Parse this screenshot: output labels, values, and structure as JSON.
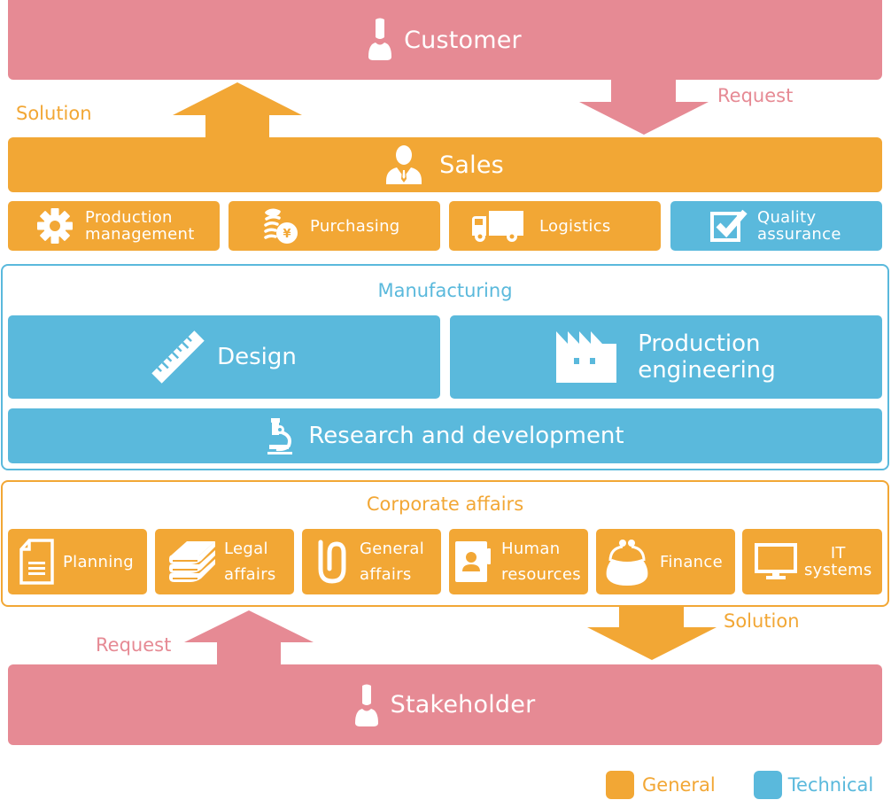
{
  "colors": {
    "pink": "#e68a94",
    "orange": "#f2a735",
    "blue": "#5ab9dc",
    "white": "#ffffff"
  },
  "customer": {
    "label": "Customer",
    "icon": "person-icon"
  },
  "sales": {
    "label": "Sales",
    "icon": "businessman-icon"
  },
  "flows": {
    "top_solution": "Solution",
    "top_request": "Request",
    "bottom_request": "Request",
    "bottom_solution": "Solution"
  },
  "sales_units": [
    {
      "label_line1": "Production",
      "label_line2": "management",
      "icon": "gear-icon",
      "category": "General"
    },
    {
      "label_line1": "Purchasing",
      "label_line2": "",
      "icon": "coins-yen-icon",
      "category": "General"
    },
    {
      "label_line1": "Logistics",
      "label_line2": "",
      "icon": "truck-icon",
      "category": "General"
    },
    {
      "label_line1": "Quality",
      "label_line2": "assurance",
      "icon": "checkbox-icon",
      "category": "Technical"
    }
  ],
  "manufacturing": {
    "title": "Manufacturing",
    "design": {
      "label": "Design",
      "icon": "ruler-icon"
    },
    "production_engineering": {
      "label_line1": "Production",
      "label_line2": "engineering",
      "icon": "factory-icon"
    },
    "rnd": {
      "label": "Research and development",
      "icon": "microscope-icon"
    }
  },
  "corporate": {
    "title": "Corporate affairs",
    "units": [
      {
        "label_line1": "Planning",
        "label_line2": "",
        "icon": "document-icon"
      },
      {
        "label_line1": "Legal",
        "label_line2": "affairs",
        "icon": "books-icon"
      },
      {
        "label_line1": "General",
        "label_line2": "affairs",
        "icon": "paperclip-icon"
      },
      {
        "label_line1": "Human",
        "label_line2": "resources",
        "icon": "id-card-icon"
      },
      {
        "label_line1": "Finance",
        "label_line2": "",
        "icon": "purse-icon"
      },
      {
        "label_line1": "IT",
        "label_line2": "systems",
        "icon": "monitor-icon"
      }
    ]
  },
  "stakeholder": {
    "label": "Stakeholder",
    "icon": "person-icon"
  },
  "legend": [
    {
      "label": "General",
      "color": "#f2a735"
    },
    {
      "label": "Technical",
      "color": "#5ab9dc"
    }
  ]
}
